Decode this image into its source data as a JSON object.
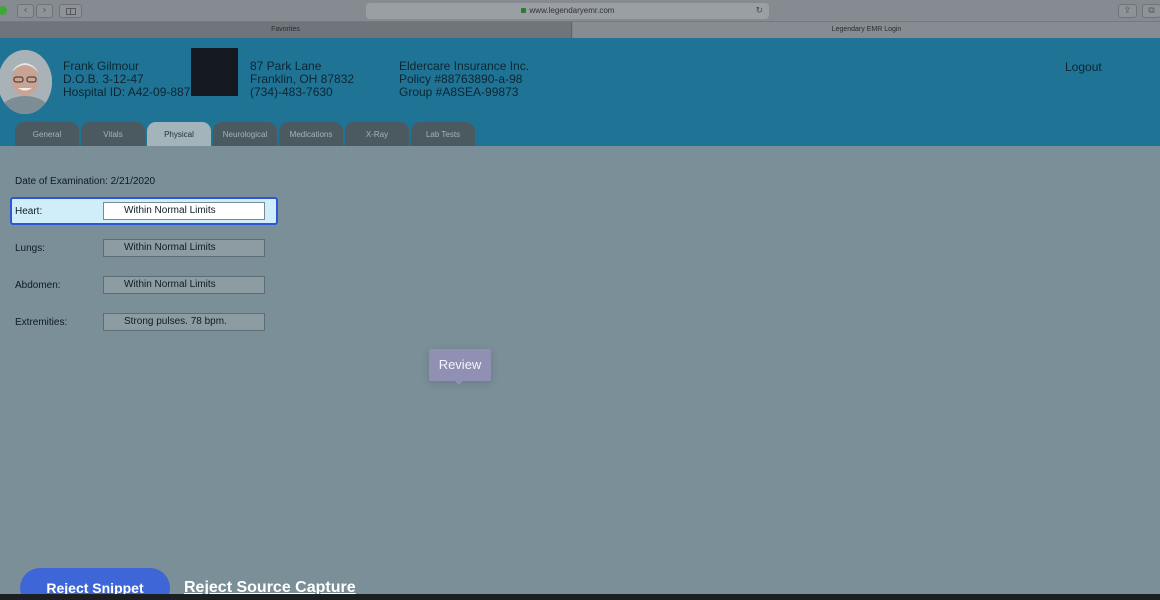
{
  "browser": {
    "url": "www.legendaryemr.com",
    "tabs": [
      "Favorites",
      "Legendary EMR Login"
    ],
    "nav_back_icon": "‹",
    "nav_forward_icon": "›",
    "reload_icon": "↻",
    "share_icon": "⇪",
    "newtab_icon": "⧉"
  },
  "patient": {
    "name": "Frank Gilmour",
    "dob": "D.O.B. 3-12-47",
    "hospital_id": "Hospital ID: A42-09-88",
    "hospital_id_tail": "7",
    "address_line1": "87 Park Lane",
    "address_line2": "Franklin, OH 87832",
    "phone": "(734)-483-7630",
    "insurer": "Eldercare Insurance Inc.",
    "policy": "Policy #88763890-a-98",
    "group": "Group #A8SEA-99873"
  },
  "logout_label": "Logout",
  "tabs": [
    "General",
    "Vitals",
    "Physical",
    "Neurological",
    "Medications",
    "X-Ray",
    "Lab Tests"
  ],
  "active_tab": "Physical",
  "exam": {
    "date_label": "Date of Examination: 2/21/2020",
    "fields": [
      {
        "label": "Heart:",
        "value": "Within Normal Limits"
      },
      {
        "label": "Lungs:",
        "value": "Within Normal Limits"
      },
      {
        "label": "Abdomen:",
        "value": "Within Normal Limits"
      },
      {
        "label": "Extremities:",
        "value": "Strong pulses. 78 bpm."
      }
    ]
  },
  "tooltip": "Review",
  "actions": {
    "reject_snippet": "Reject Snippet",
    "reject_source_capture": "Reject Source Capture"
  },
  "colors": {
    "header": "#1f7496",
    "focus_border": "#2a58d6",
    "primary_button": "#3f66d6"
  }
}
